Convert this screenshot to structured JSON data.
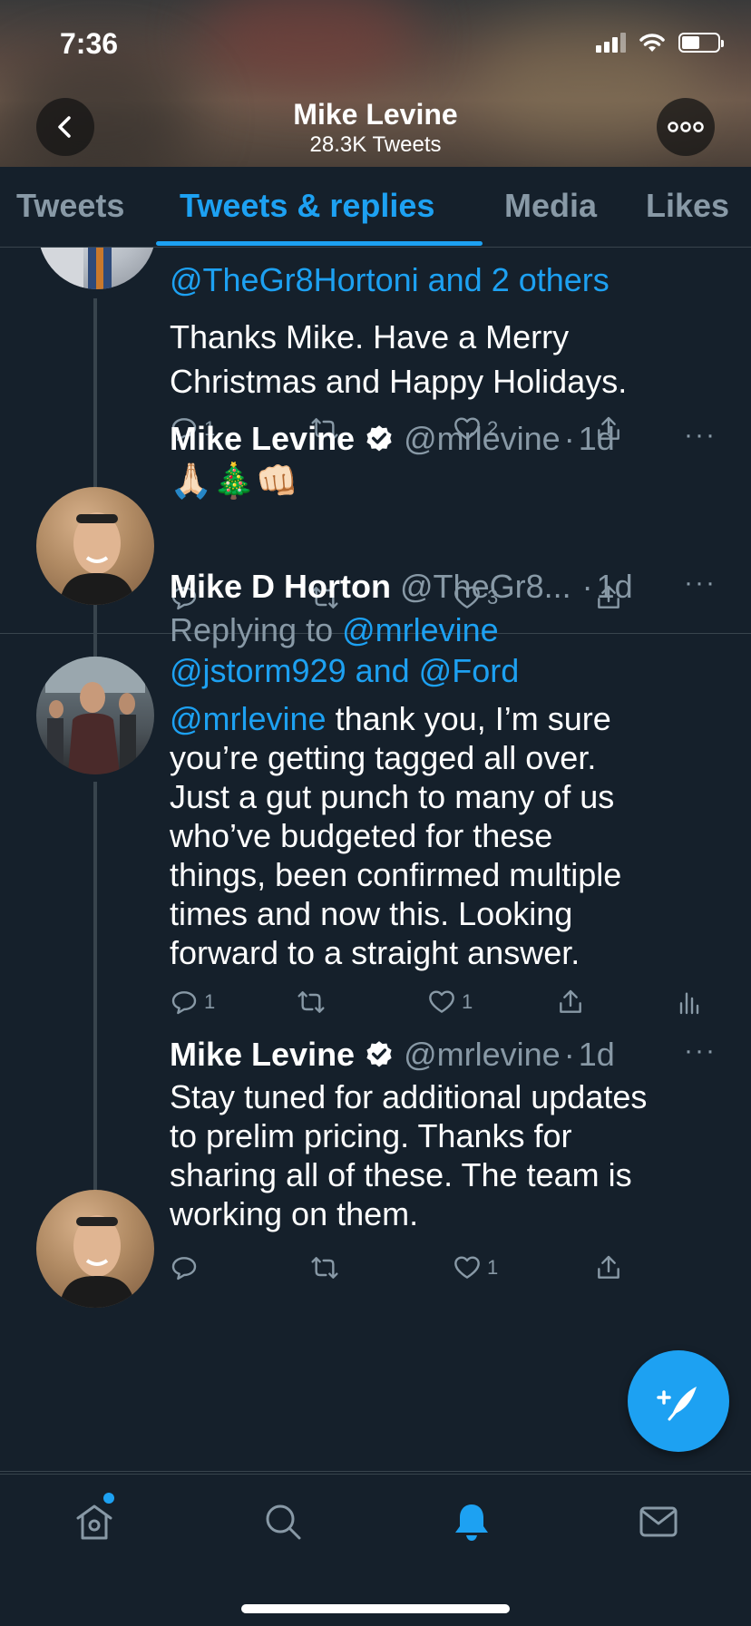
{
  "status_bar": {
    "time": "7:36"
  },
  "header": {
    "name": "Mike Levine",
    "tweet_count": "28.3K Tweets"
  },
  "tabs": [
    {
      "label": "Tweets",
      "active": false
    },
    {
      "label": "Tweets & replies",
      "active": true
    },
    {
      "label": "Media",
      "active": false
    },
    {
      "label": "Likes",
      "active": false
    }
  ],
  "tweets": [
    {
      "replying_mentions": "@TheGr8Hortoni and 2 others",
      "text_lines": [
        "Thanks Mike.   Have a Merry",
        "Christmas and Happy Holidays."
      ],
      "reply_count": "1",
      "retweet_count": "",
      "like_count": "2"
    },
    {
      "name": "Mike Levine",
      "handle": "@mrlevine",
      "time": "1d",
      "text": "🙏🏻🎄👊🏻",
      "reply_count": "",
      "retweet_count": "",
      "like_count": "3"
    },
    {
      "name": "Mike D Horton",
      "handle": "@TheGr8...",
      "time": "1d",
      "replying_prefix": "Replying to",
      "replying_line1": "@mrlevine",
      "replying_line2": "@jstorm929 and @Ford",
      "mention": "@mrlevine",
      "text_line1_rest": " thank you, I’m sure",
      "text_lines": [
        "you’re getting tagged all over.",
        "Just a gut punch to many of us",
        "who’ve budgeted for these",
        "things, been confirmed multiple",
        "times and now this. Looking",
        "forward to a straight answer."
      ],
      "reply_count": "1",
      "retweet_count": "",
      "like_count": "1"
    },
    {
      "name": "Mike Levine",
      "handle": "@mrlevine",
      "time": "1d",
      "text_lines": [
        "Stay tuned for additional updates",
        "to prelim pricing. Thanks for",
        "sharing all of these. The team is",
        "working on them."
      ],
      "reply_count": "",
      "retweet_count": "",
      "like_count": "1"
    }
  ],
  "colors": {
    "accent": "#1da1f2",
    "background": "#15202b",
    "muted": "#8899a6",
    "border": "#38444d"
  },
  "icons": [
    "back-icon",
    "more-icon",
    "reply-icon",
    "retweet-icon",
    "like-icon",
    "share-icon",
    "analytics-icon",
    "verified-icon",
    "compose-icon",
    "home-icon",
    "search-icon",
    "notifications-icon",
    "messages-icon"
  ]
}
